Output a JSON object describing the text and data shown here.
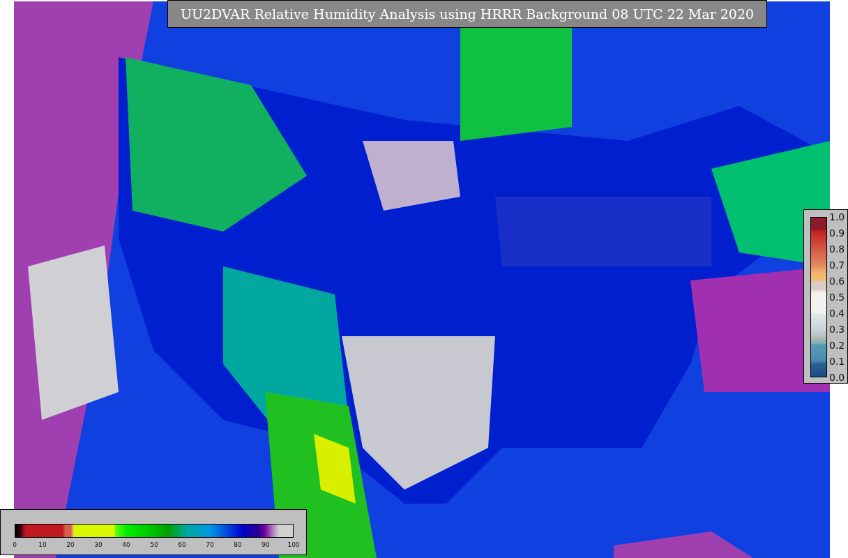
{
  "title": "UU2DVAR Relative Humidity Analysis using HRRR Background 08 UTC 22 Mar 2020",
  "side_colorbar": {
    "ticks": [
      "1.0",
      "0.9",
      "0.8",
      "0.7",
      "0.6",
      "0.5",
      "0.4",
      "0.3",
      "0.2",
      "0.1",
      "0.0"
    ]
  },
  "bottom_colorbar": {
    "ticks": [
      "0",
      "10",
      "20",
      "30",
      "40",
      "50",
      "60",
      "70",
      "80",
      "90",
      "100"
    ]
  }
}
